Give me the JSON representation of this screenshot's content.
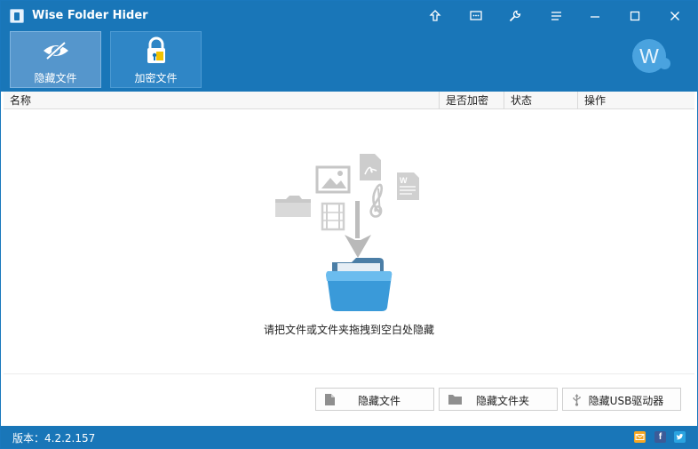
{
  "window": {
    "title": "Wise Folder Hider"
  },
  "toolbar": {
    "tools": [
      {
        "label": "隐藏文件",
        "icon": "eye-slash-icon"
      },
      {
        "label": "加密文件",
        "icon": "lock-icon"
      }
    ],
    "avatar_letter": "W"
  },
  "titlebar_buttons": [
    "upgrade-icon",
    "feedback-icon",
    "settings-icon",
    "menu-icon",
    "minimize-icon",
    "maximize-icon",
    "close-icon"
  ],
  "table": {
    "columns": [
      "名称",
      "是否加密",
      "状态",
      "操作"
    ]
  },
  "empty_state": {
    "message": "请把文件或文件夹拖拽到空白处隐藏",
    "icons": [
      "folder-icon",
      "image-icon",
      "pdf-icon",
      "word-doc-icon",
      "music-note-icon",
      "film-icon",
      "down-arrow-icon",
      "open-folder-icon"
    ]
  },
  "actions": [
    {
      "label": "隐藏文件",
      "icon": "file-icon"
    },
    {
      "label": "隐藏文件夹",
      "icon": "folder-icon"
    },
    {
      "label": "隐藏USB驱动器",
      "icon": "usb-icon"
    }
  ],
  "status": {
    "version": "版本：4.2.2.157",
    "social": [
      "email-icon",
      "facebook-icon",
      "twitter-icon"
    ]
  },
  "colors": {
    "accent": "#1976b8",
    "active_tool": "#5596cc",
    "folder": "#3a9ad9"
  }
}
